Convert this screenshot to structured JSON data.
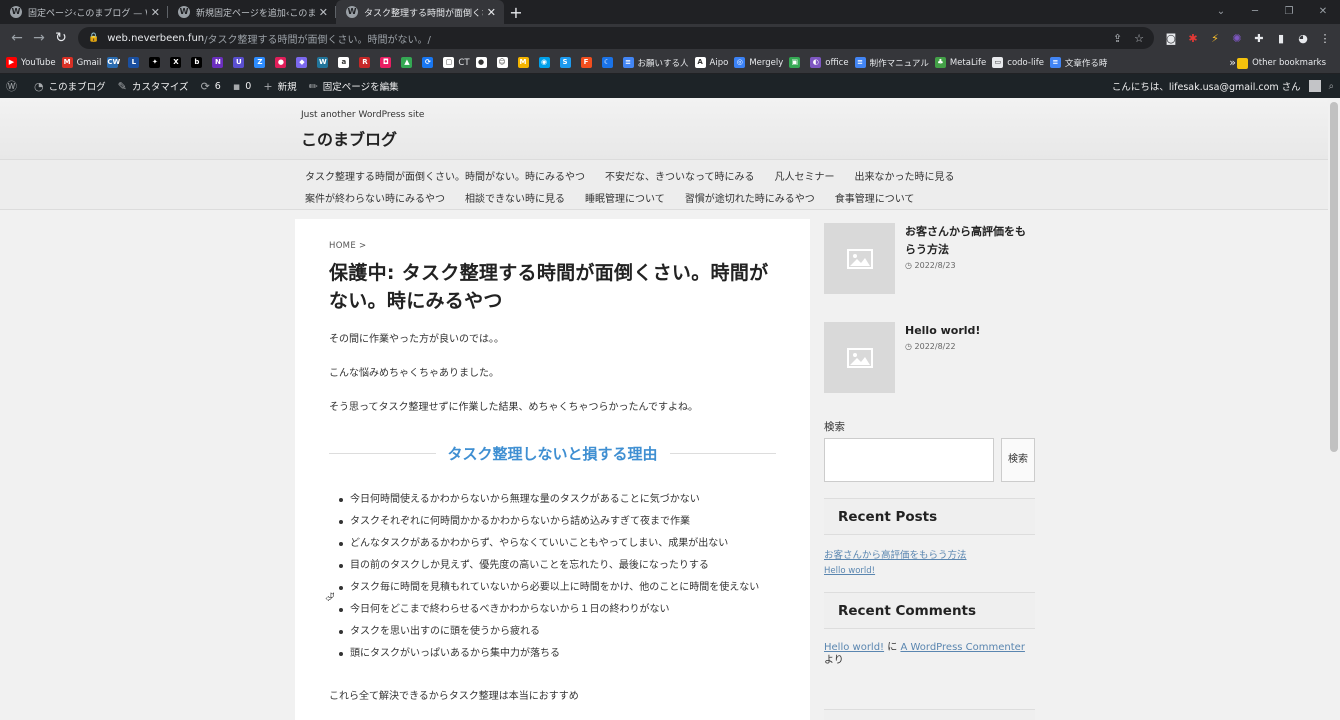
{
  "browser": {
    "tabs": [
      {
        "title": "固定ページ‹このまブログ — WordPr",
        "active": false
      },
      {
        "title": "新規固定ページを追加‹このまブログ",
        "active": false
      },
      {
        "title": "タスク整理する時間が面倒くさい。時",
        "active": true
      }
    ],
    "url_host": "web.neverbeen.fun",
    "url_path": "/タスク整理する時間が面倒くさい。時間がない。/",
    "bookmarks": [
      {
        "label": "YouTube",
        "color": "#ff0000",
        "glyph": "▶"
      },
      {
        "label": "Gmail",
        "color": "#d93025",
        "glyph": "M"
      },
      {
        "label": "",
        "color": "#2b6cb0",
        "glyph": "CW"
      },
      {
        "label": "",
        "color": "#1a4fa0",
        "glyph": "L"
      },
      {
        "label": "",
        "color": "#000000",
        "glyph": "✦"
      },
      {
        "label": "",
        "color": "#000000",
        "glyph": "X"
      },
      {
        "label": "",
        "color": "#000000",
        "glyph": "b"
      },
      {
        "label": "",
        "color": "#6b2fbf",
        "glyph": "N"
      },
      {
        "label": "",
        "color": "#5a4fcf",
        "glyph": "U"
      },
      {
        "label": "",
        "color": "#2d8cff",
        "glyph": "Z"
      },
      {
        "label": "",
        "color": "#e01e5a",
        "glyph": "●"
      },
      {
        "label": "",
        "color": "#7b68ee",
        "glyph": "◆"
      },
      {
        "label": "",
        "color": "#21759b",
        "glyph": "W"
      },
      {
        "label": "",
        "color": "#ffffff",
        "glyph": "a"
      },
      {
        "label": "",
        "color": "#c62828",
        "glyph": "R"
      },
      {
        "label": "",
        "color": "#e91e63",
        "glyph": "◘"
      },
      {
        "label": "",
        "color": "#34a853",
        "glyph": "▲"
      },
      {
        "label": "",
        "color": "#1877f2",
        "glyph": "⟳"
      },
      {
        "label": "CT",
        "color": "#ffffff",
        "glyph": "▢"
      },
      {
        "label": "",
        "color": "#ffffff",
        "glyph": "●"
      },
      {
        "label": "",
        "color": "#ffffff",
        "glyph": "☺"
      },
      {
        "label": "",
        "color": "#f4b400",
        "glyph": "M"
      },
      {
        "label": "",
        "color": "#00a0e9",
        "glyph": "◉"
      },
      {
        "label": "",
        "color": "#1d9bf0",
        "glyph": "S"
      },
      {
        "label": "",
        "color": "#f24e1e",
        "glyph": "F"
      },
      {
        "label": "",
        "color": "#1a73e8",
        "glyph": "☾"
      },
      {
        "label": "お願いする人",
        "color": "#4285f4",
        "glyph": "≡"
      },
      {
        "label": "Aipo",
        "color": "#ffffff",
        "glyph": "A"
      },
      {
        "label": "Mergely",
        "color": "#3b82f6",
        "glyph": "◎"
      },
      {
        "label": "",
        "color": "#34a853",
        "glyph": "▣"
      },
      {
        "label": "office",
        "color": "#7e57c2",
        "glyph": "◐"
      },
      {
        "label": "制作マニュアル",
        "color": "#4285f4",
        "glyph": "≡"
      },
      {
        "label": "MetaLife",
        "color": "#43a047",
        "glyph": "♣"
      },
      {
        "label": "codo-life",
        "color": "#e8eaed",
        "glyph": "▭"
      },
      {
        "label": "文章作る時",
        "color": "#4285f4",
        "glyph": "≡"
      }
    ],
    "other_bookmarks": "Other bookmarks",
    "overflow": "»"
  },
  "adminbar": {
    "site_name": "このまブログ",
    "customize": "カスタマイズ",
    "updates_count": "6",
    "comments_count": "0",
    "new": "新規",
    "edit_page": "固定ページを編集",
    "greeting": "こんにちは、lifesak.usa@gmail.com さん"
  },
  "site": {
    "tagline": "Just another WordPress site",
    "title": "このまブログ"
  },
  "gnav": {
    "row1": [
      "タスク整理する時間が面倒くさい。時間がない。時にみるやつ",
      "不安だな、きついなって時にみる",
      "凡人セミナー",
      "出来なかった時に見る"
    ],
    "row2": [
      "案件が終わらない時にみるやつ",
      "相談できない時に見る",
      "睡眠管理について",
      "習慣が途切れた時にみるやつ",
      "食事管理について"
    ]
  },
  "article": {
    "breadcrumb": "HOME >",
    "title": "保護中: タスク整理する時間が面倒くさい。時間がない。時にみるやつ",
    "para1": "その間に作業やった方が良いのでは。。",
    "para2": "こんな悩みめちゃくちゃありました。",
    "para3": "そう思ってタスク整理せずに作業した結果、めちゃくちゃつらかったんですよね。",
    "heading": "タスク整理しないと損する理由",
    "reasons": [
      "今日何時間使えるかわからないから無理な量のタスクがあることに気づかない",
      "タスクそれぞれに何時間かかるかわからないから詰め込みすぎて夜まで作業",
      "どんなタスクがあるかわからず、やらなくていいこともやってしまい、成果が出ない",
      "目の前のタスクしか見えず、優先度の高いことを忘れたり、最後になったりする",
      "タスク毎に時間を見積もれていないから必要以上に時間をかけ、他のことに時間を使えない",
      "今日何をどこまで終わらせるべきかわからないから１日の終わりがない",
      "タスクを思い出すのに頭を使うから疲れる",
      "頭にタスクがいっぱいあるから集中力が落ちる"
    ],
    "conclusion": "これら全て解決できるからタスク整理は本当におすすめ"
  },
  "sidebar": {
    "posts": [
      {
        "title": "お客さんから高評価をもらう方法",
        "date": "2022/8/23"
      },
      {
        "title": "Hello world!",
        "date": "2022/8/22"
      }
    ],
    "search_label": "検索",
    "search_button": "検索",
    "recent_posts_heading": "Recent Posts",
    "recent_posts": [
      "お客さんから高評価をもらう方法",
      "Hello world!"
    ],
    "recent_comments_heading": "Recent Comments",
    "comment": {
      "post": "Hello world!",
      "joiner": "に",
      "author": "A WordPress Commenter",
      "suffix": "より"
    }
  }
}
